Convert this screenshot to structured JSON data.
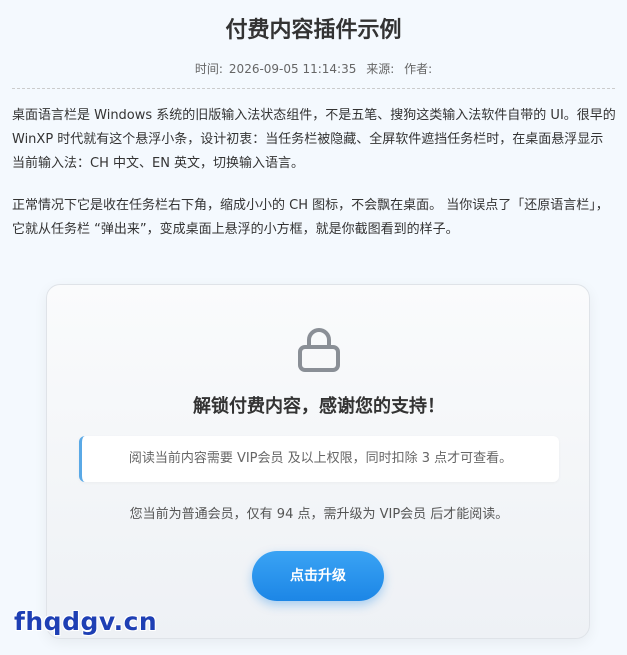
{
  "article": {
    "title": "付费内容插件示例",
    "meta": {
      "time_label": "时间:",
      "time_value": "2026-09-05 11:14:35",
      "source_label": "来源:",
      "author_label": "作者:"
    },
    "paragraphs": [
      "桌面语言栏是 Windows 系统的旧版输入法状态组件，不是五笔、搜狗这类输入法软件自带的 UI。很早的 WinXP 时代就有这个悬浮小条，设计初衷：当任务栏被隐藏、全屏软件遮挡任务栏时，在桌面悬浮显示当前输入法：CH 中文、EN 英文，切换输入语言。",
      "正常情况下它是收在任务栏右下角，缩成小小的 CH 图标，不会飘在桌面。 当你误点了「还原语言栏」，它就从任务栏 “弹出来”，变成桌面上悬浮的小方框，就是你截图看到的样子。"
    ]
  },
  "paywall": {
    "icon": "lock-icon",
    "heading": "解锁付费内容，感谢您的支持！",
    "notice": "阅读当前内容需要 VIP会员 及以上权限，同时扣除 3 点才可查看。",
    "status": "您当前为普通会员，仅有 94 点，需升级为 VIP会员 后才能阅读。",
    "upgrade_button": "点击升级",
    "accent_color": "#2a93ef"
  },
  "watermark": {
    "text": "fhqdgv.cn"
  }
}
